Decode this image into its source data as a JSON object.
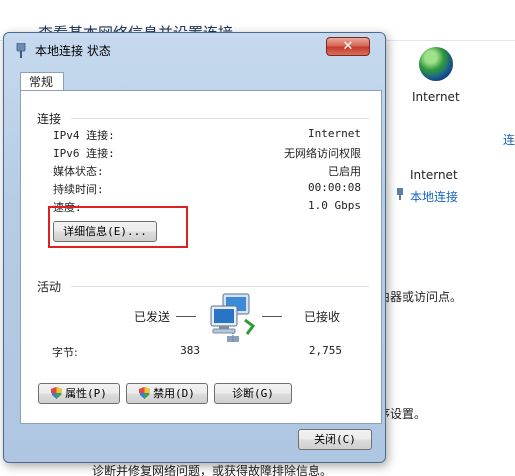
{
  "background": {
    "title": "查看基本网络信息并设置连接",
    "internet_top": "Internet",
    "link_fragment": "连",
    "internet_access": "Internet",
    "local_link": "本地连接",
    "text_router": "由器或访问点。",
    "text_2": "。",
    "text_settings": "序设置。",
    "text_diagnose": "诊断并修复网络问题，或获得故障排除信息。"
  },
  "dialog": {
    "title": "本地连接 状态",
    "close_glyph": "✕",
    "tab": "常规",
    "connection_section": "连接",
    "rows": [
      {
        "label": "IPv4 连接:",
        "value": "Internet"
      },
      {
        "label": "IPv6 连接:",
        "value": "无网络访问权限"
      },
      {
        "label": "媒体状态:",
        "value": "已启用"
      },
      {
        "label": "持续时间:",
        "value": "00:00:08"
      },
      {
        "label": "速度:",
        "value": "1.0 Gbps"
      }
    ],
    "details_button": "详细信息(E)...",
    "activity_section": "活动",
    "sent_label": "已发送",
    "received_label": "已接收",
    "bytes_label": "字节:",
    "bytes_sent": "383",
    "bytes_received": "2,755",
    "properties_button": "属性(P)",
    "disable_button": "禁用(D)",
    "diagnose_button": "诊断(G)",
    "close_button": "关闭(C)"
  },
  "colors": {
    "highlight": "#e02020",
    "link": "#1565c0"
  }
}
